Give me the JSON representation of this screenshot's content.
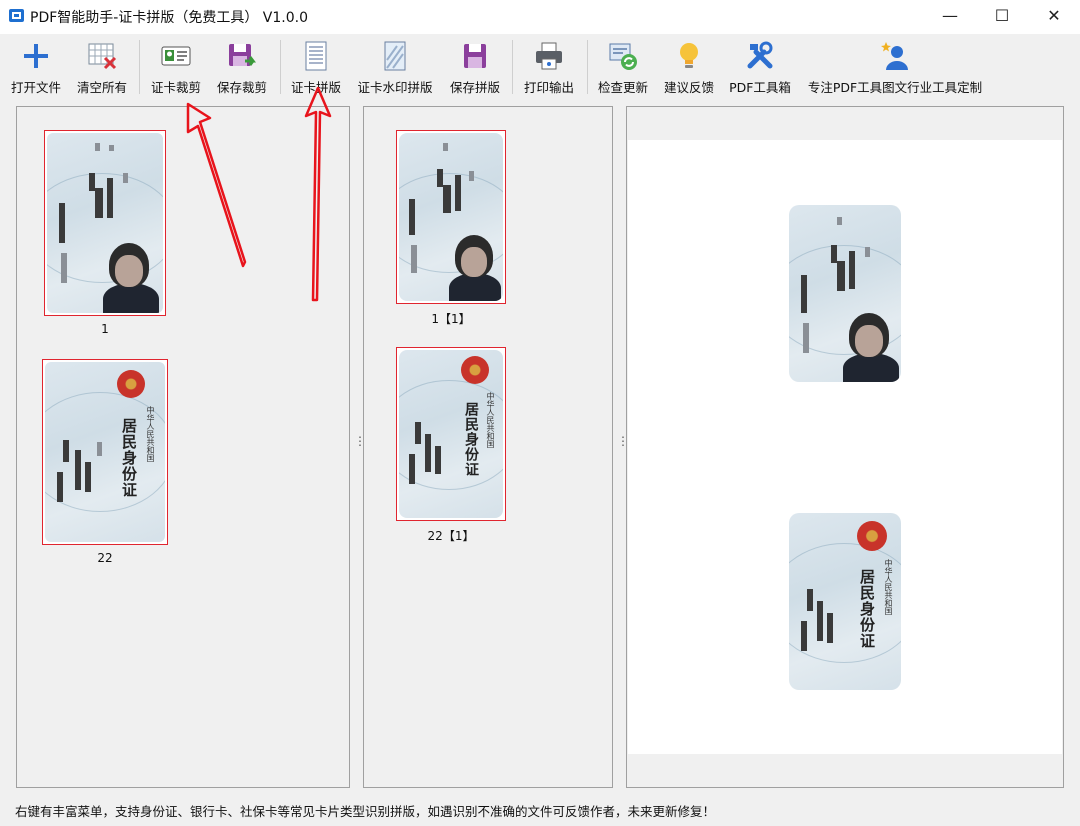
{
  "window": {
    "title": "PDF智能助手-证卡拼版（免费工具） V1.0.0",
    "min_icon": "minimize-icon",
    "max_icon": "maximize-icon",
    "close_icon": "close-icon"
  },
  "toolbar": {
    "open_file": "打开文件",
    "clear_all": "清空所有",
    "card_crop": "证卡裁剪",
    "save_crop": "保存裁剪",
    "card_layout": "证卡拼版",
    "card_watermark_layout": "证卡水印拼版",
    "save_layout": "保存拼版",
    "print_output": "打印输出",
    "check_update": "检查更新",
    "feedback": "建议反馈",
    "pdf_toolbox": "PDF工具箱",
    "custom_tools": "专注PDF工具图文行业工具定制"
  },
  "left_panel": {
    "items": [
      {
        "caption": "1"
      },
      {
        "caption": "22"
      }
    ]
  },
  "middle_panel": {
    "items": [
      {
        "caption": "1【1】"
      },
      {
        "caption": "22【1】"
      }
    ]
  },
  "id_card_back": {
    "title": "居民身份证",
    "subtitle": "中华人民共和国"
  },
  "statusbar": {
    "text": "右键有丰富菜单，支持身份证、银行卡、社保卡等常见卡片类型识别拼版，如遇识别不准确的文件可反馈作者，未来更新修复！"
  },
  "colors": {
    "selection_border": "#e0252f",
    "annotation_arrow": "#e8141c",
    "accent_blue": "#2d6fd0",
    "accent_purple": "#8b3f9c"
  }
}
